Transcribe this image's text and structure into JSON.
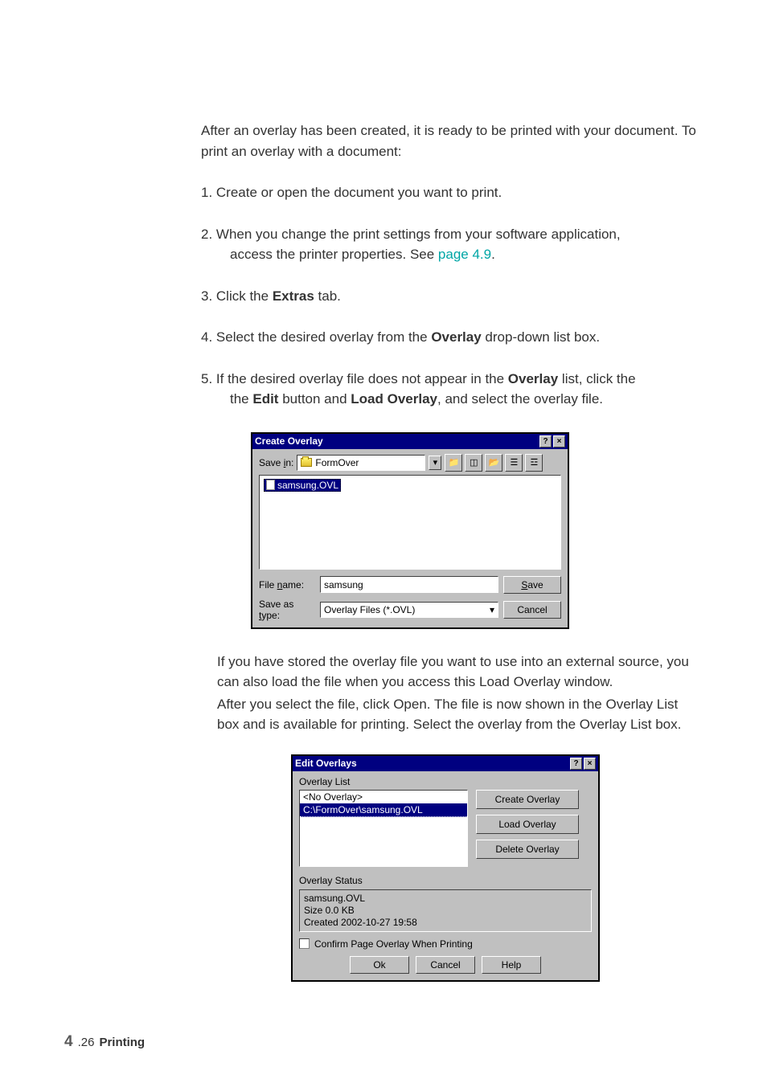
{
  "intro": "After an overlay has been created, it is ready to be printed with your document. To print an overlay with a document:",
  "steps": {
    "s1": "1. Create or open the document you want to print.",
    "s2a": "2. When you change the print settings from your software application,",
    "s2b": "access the printer properties. See ",
    "s2_link": "page 4.9",
    "s3a": "3. Click the ",
    "s3b_bold": "Extras",
    "s3c": " tab.",
    "s4a": "4. Select the desired overlay from the ",
    "s4b_bold": "Overlay",
    "s4c": " drop-down list box.",
    "s5a": "5. If the desired overlay file does not appear in the ",
    "s5b_bold": "Overlay",
    "s5c": " list, click the ",
    "s5d_bold": "Edit",
    "s5e": " button and ",
    "s5f_bold": "Load Overlay",
    "s5g": ", and select the overlay file."
  },
  "dialog1": {
    "title": "Create Overlay",
    "help_btn": "?",
    "close_btn": "×",
    "save_in_label": "Save in:",
    "save_in_value": "FormOver",
    "file_item": "samsung.OVL",
    "filename_label": "File name:",
    "filename_value": "samsung",
    "savetype_label": "Save as type:",
    "savetype_value": "Overlay Files (*.OVL)",
    "save_btn": "Save",
    "cancel_btn": "Cancel"
  },
  "para1": "If you have stored the overlay file you want to use into an external source, you can also load the file when you access this Load Overlay window.",
  "para2": "After you select the file, click Open. The file is now shown in the Overlay List box and is available for printing. Select the overlay from the Overlay List box.",
  "dialog2": {
    "title": "Edit Overlays",
    "help_btn": "?",
    "close_btn": "×",
    "overlay_list_label": "Overlay List",
    "list": {
      "item1": "<No Overlay>",
      "item2": "C:\\FormOver\\samsung.OVL"
    },
    "buttons": {
      "create": "Create Overlay",
      "load": "Load Overlay",
      "del": "Delete Overlay"
    },
    "status_label": "Overlay Status",
    "status": {
      "l1": "samsung.OVL",
      "l2": "Size 0.0 KB",
      "l3": "Created 2002-10-27 19:58"
    },
    "confirm": "Confirm Page Overlay When Printing",
    "ok": "Ok",
    "cancel": "Cancel",
    "help": "Help"
  },
  "footer": {
    "chapter": "4",
    "page": ".26",
    "section": "Printing"
  }
}
